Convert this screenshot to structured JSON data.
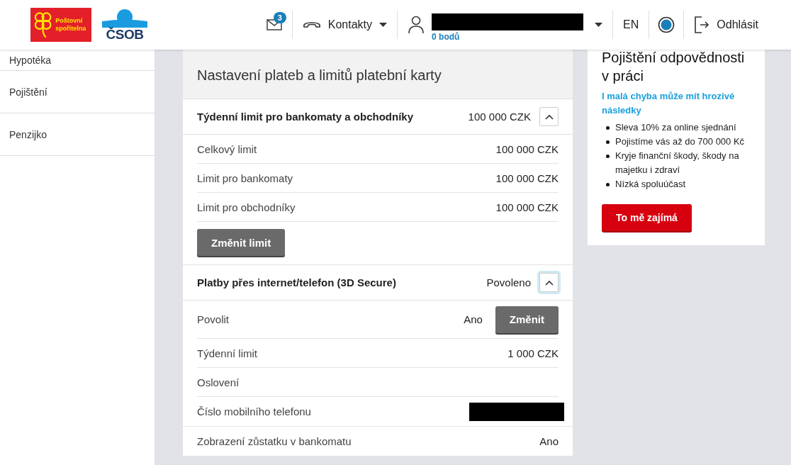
{
  "header": {
    "logos": [
      {
        "kind": "postovni",
        "text": "Poštovní spořitelna"
      },
      {
        "kind": "csob",
        "text": "ČSOB"
      }
    ],
    "messages_badge": "3",
    "contacts": "Kontakty",
    "user": {
      "name_redacted": true,
      "points": "0 bodů"
    },
    "language": "EN",
    "logout": "Odhlásit"
  },
  "sidebar": {
    "items": [
      {
        "label": "Hypotéka"
      },
      {
        "label": "Pojištění"
      },
      {
        "label": "Penzijko"
      }
    ]
  },
  "panel": {
    "title": "Nastavení plateb a limitů platební karty",
    "sections": [
      {
        "title": "Týdenní limit pro bankomaty a obchodníky",
        "value": "100 000 CZK",
        "expanded": true,
        "focused": false,
        "rows": [
          {
            "label": "Celkový limit",
            "value": "100 000 CZK"
          },
          {
            "label": "Limit pro bankomaty",
            "value": "100 000 CZK"
          },
          {
            "label": "Limit pro obchodníky",
            "value": "100 000 CZK"
          }
        ],
        "button": "Změnit limit"
      },
      {
        "title": "Platby přes internet/telefon (3D Secure)",
        "value": "Povoleno",
        "expanded": true,
        "focused": true,
        "rows": [
          {
            "label": "Povolit",
            "value": "Ano",
            "button": "Změnit"
          },
          {
            "label": "Týdenní limit",
            "value": "1 000 CZK"
          },
          {
            "label": "Oslovení"
          },
          {
            "label": "Číslo mobilního telefonu",
            "redacted": true
          }
        ]
      }
    ],
    "footer_row": {
      "label": "Zobrazení zůstatku v bankomatu",
      "value": "Ano"
    }
  },
  "promo": {
    "title": "Pojištění odpovědnosti v práci",
    "subtitle": "I malá chyba může mít hrozivé následky",
    "bullets": [
      "Sleva 10% za online sjednání",
      "Pojistíme vás až do 700 000 Kč",
      "Kryje finanční škody, škody na majetku i zdraví",
      "Nízká spoluúčast"
    ],
    "button": "To mě zajímá"
  }
}
